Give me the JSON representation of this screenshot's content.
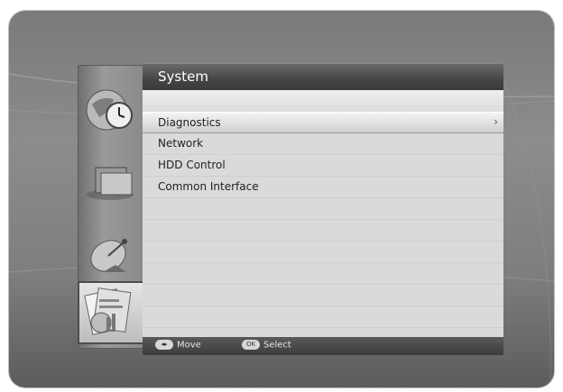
{
  "menu": {
    "title": "System",
    "items": [
      {
        "label": "Diagnostics",
        "selected": true,
        "has_submenu": true
      },
      {
        "label": "Network",
        "selected": false
      },
      {
        "label": "HDD Control",
        "selected": false
      },
      {
        "label": "Common Interface",
        "selected": false
      }
    ],
    "submenu_indicator": "›"
  },
  "rail": {
    "icons": [
      "clock-globe-icon",
      "folder-icon",
      "satellite-dish-icon",
      "system-documents-icon"
    ],
    "selected_index": 3
  },
  "footer": {
    "move_key": "◂▸",
    "move_label": "Move",
    "select_key": "OK",
    "select_label": "Select"
  }
}
